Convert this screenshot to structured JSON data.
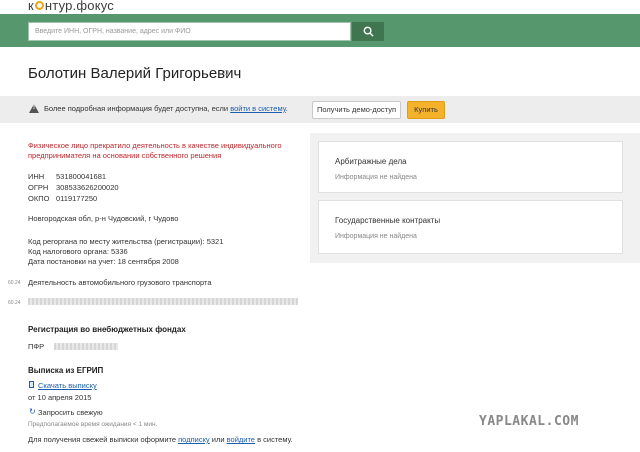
{
  "logo": {
    "text_before": "к",
    "text_after": "нтур.фокус"
  },
  "search": {
    "placeholder": "Введите ИНН, ОГРН, название, адрес или ФИО"
  },
  "title": "Болотин Валерий Григорьевич",
  "title_icon": "Q",
  "notice": {
    "text": "Более подробная информация будет доступна, если ",
    "link": "войти в систему",
    "suffix": ".",
    "demo_button": "Получить демо-доступ",
    "buy_button": "Купить"
  },
  "status": {
    "line1": "Физическое лицо прекратило деятельность в качестве индивидуального",
    "line2": "предпринимателя на основании собственного решения"
  },
  "ids": [
    {
      "label": "ИНН",
      "value": "531800041681"
    },
    {
      "label": "ОГРН",
      "value": "308533626200020"
    },
    {
      "label": "ОКПО",
      "value": "0119177250"
    }
  ],
  "address": "Новгородская обл, р-н Чудовский, г Чудово",
  "registration": {
    "line1": "Код регоргана по месту жительства (регистрации): 5321",
    "line2": "Код налогового органа: 5336",
    "line3": "Дата постановки на учет: 18 сентября 2008"
  },
  "activities": [
    {
      "code": "60.24",
      "text": "Деятельность автомобильного грузового транспорта"
    },
    {
      "code": "60.24",
      "text": ""
    }
  ],
  "funds": {
    "heading": "Регистрация во внебюджетных фондах",
    "label": "ПФР"
  },
  "egrip": {
    "heading": "Выписка из ЕГРИП",
    "download": "Скачать выписку",
    "date": "от 10 апреля 2015",
    "request": "Запросить свежую",
    "wait": "Предполагаемое время ожидания < 1 мин.",
    "footer_before": "Для получения свежей выписки оформите ",
    "footer_link1": "подписку",
    "footer_mid": " или ",
    "footer_link2": "войдите",
    "footer_after": " в систему."
  },
  "cards": [
    {
      "title": "Арбитражные дела",
      "sub": "Информация не найдена"
    },
    {
      "title": "Государственные контракты",
      "sub": "Информация не найдена"
    }
  ],
  "watermark": "YAPLAKAL.COM",
  "colors": {
    "header": "#57976d",
    "accent_button": "#f4b22b",
    "link": "#1a5eb0",
    "warning_text": "#c0262c"
  }
}
